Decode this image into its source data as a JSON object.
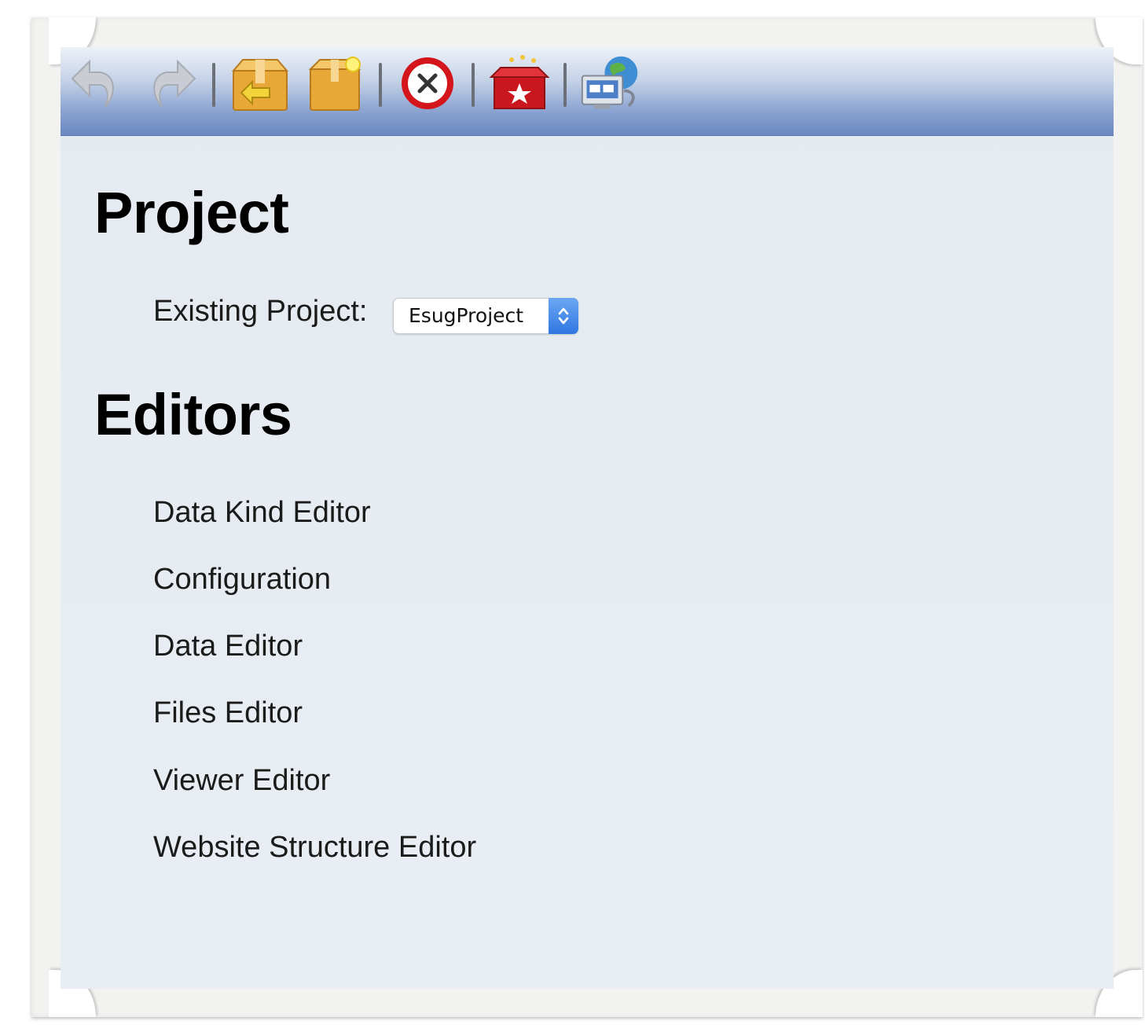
{
  "toolbar": {
    "buttons": [
      {
        "name": "undo",
        "icon": "undo-arrow-icon"
      },
      {
        "name": "redo",
        "icon": "redo-arrow-icon"
      },
      {
        "name": "open-project",
        "icon": "package-open-icon"
      },
      {
        "name": "new-project",
        "icon": "package-new-icon"
      },
      {
        "name": "close",
        "icon": "close-circle-icon"
      },
      {
        "name": "deploy",
        "icon": "gift-box-icon"
      },
      {
        "name": "network",
        "icon": "network-computer-icon"
      }
    ],
    "colors": {
      "gradient_top": "#eef2f8",
      "gradient_bottom": "#6b87c2"
    }
  },
  "project": {
    "heading": "Project",
    "existing_label": "Existing Project:",
    "selected_project": "EsugProject"
  },
  "editors": {
    "heading": "Editors",
    "items": [
      {
        "label": "Data Kind Editor"
      },
      {
        "label": "Configuration"
      },
      {
        "label": "Data Editor"
      },
      {
        "label": "Files Editor"
      },
      {
        "label": "Viewer Editor"
      },
      {
        "label": "Website Structure Editor"
      }
    ]
  }
}
